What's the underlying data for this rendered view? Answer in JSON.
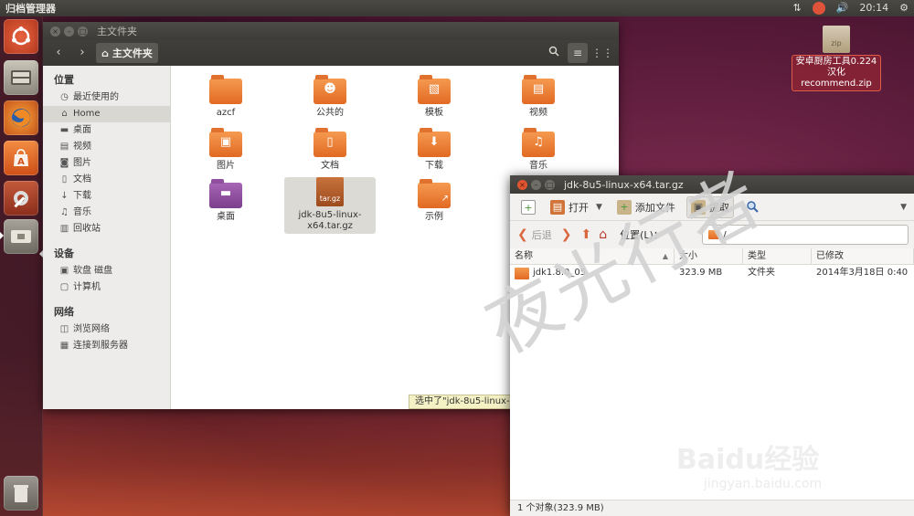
{
  "top_panel": {
    "app_name": "归档管理器",
    "clock": "20:14",
    "net_icon": "⇅",
    "volume_icon": "🔊",
    "settings_icon": "⚙"
  },
  "launcher": {
    "items": [
      "ubuntu-icon",
      "files-icon",
      "firefox-icon",
      "software-center-icon",
      "system-settings-icon",
      "archive-manager-icon",
      "trash-icon"
    ]
  },
  "desktop": {
    "zip_icon_label": "zip",
    "zip_file_name": "安卓厨房工具0.224汉化 recommend.zip"
  },
  "file_manager": {
    "title": "主文件夹",
    "path_button": "主文件夹",
    "sidebar": {
      "places_heading": "位置",
      "places": [
        "最近使用的",
        "Home",
        "桌面",
        "视频",
        "图片",
        "文档",
        "下载",
        "音乐",
        "回收站"
      ],
      "devices_heading": "设备",
      "devices": [
        "软盘 磁盘",
        "计算机"
      ],
      "network_heading": "网络",
      "network": [
        "浏览网络",
        "连接到服务器"
      ]
    },
    "files": [
      {
        "name": "azcf"
      },
      {
        "name": "公共的"
      },
      {
        "name": "模板"
      },
      {
        "name": "视频"
      },
      {
        "name": "图片"
      },
      {
        "name": "文档"
      },
      {
        "name": "下载"
      },
      {
        "name": "音乐"
      },
      {
        "name": "桌面"
      },
      {
        "name": "jdk-8u5-linux-x64.tar.gz",
        "badge": "tar.gz"
      },
      {
        "name": "示例"
      }
    ],
    "status": "选中了\"jdk-8u5-linux-"
  },
  "archive_manager": {
    "title": "jdk-8u5-linux-x64.tar.gz",
    "toolbar": {
      "open": "打开",
      "add_files": "添加文件",
      "extract": "提取"
    },
    "nav": {
      "back": "后退",
      "location_label": "位置(L)：",
      "location_value": "/"
    },
    "columns": [
      "名称",
      "大小",
      "类型",
      "已修改"
    ],
    "rows": [
      {
        "name": "jdk1.8.0_05",
        "size": "323.9 MB",
        "type": "文件夹",
        "modified": "2014年3月18日 0:40"
      }
    ],
    "status": "1 个对象(323.9 MB)"
  },
  "watermark": {
    "text": "夜光行者",
    "brand": "Baidu经验",
    "url": "jingyan.baidu.com"
  }
}
